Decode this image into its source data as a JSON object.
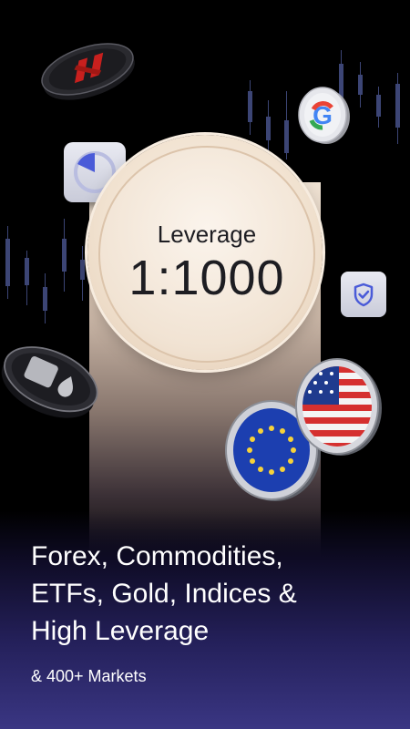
{
  "hero": {
    "label": "Leverage",
    "value": "1:1000"
  },
  "headline": {
    "lines": [
      "Forex, Commodities,",
      "ETFs, Gold, Indices &",
      "High Leverage"
    ]
  },
  "subline": "& 400+ Markets",
  "icons": {
    "timer": "timer-icon",
    "shield": "shield-check-icon",
    "google": "google-coin-icon",
    "netflix": "netflix-coin-icon",
    "oil": "oil-coin-icon",
    "eu": "eu-flag-coin-icon",
    "us": "us-flag-coin-icon"
  },
  "colors": {
    "background": "#000000",
    "accent": "#4a5bd8",
    "text": "#ffffff",
    "medal": "#f1e3d3"
  }
}
